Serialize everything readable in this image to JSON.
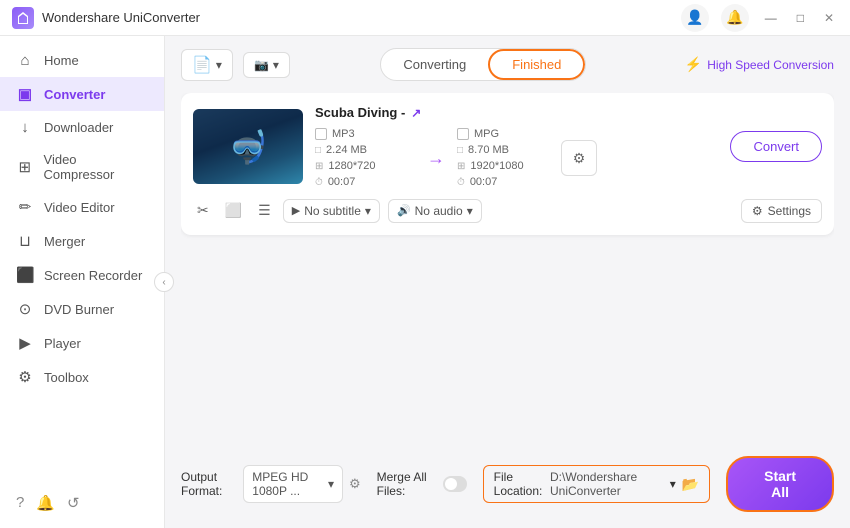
{
  "app": {
    "title": "Wondershare UniConverter"
  },
  "titlebar": {
    "icons": {
      "user": "👤",
      "bell": "🔔",
      "minimize": "—",
      "maximize": "□",
      "close": "✕"
    }
  },
  "sidebar": {
    "items": [
      {
        "id": "home",
        "label": "Home",
        "icon": "⌂"
      },
      {
        "id": "converter",
        "label": "Converter",
        "icon": "▣",
        "active": true
      },
      {
        "id": "downloader",
        "label": "Downloader",
        "icon": "↓"
      },
      {
        "id": "video-compressor",
        "label": "Video Compressor",
        "icon": "⊞"
      },
      {
        "id": "video-editor",
        "label": "Video Editor",
        "icon": "✏"
      },
      {
        "id": "merger",
        "label": "Merger",
        "icon": "⊔"
      },
      {
        "id": "screen-recorder",
        "label": "Screen Recorder",
        "icon": "⬛"
      },
      {
        "id": "dvd-burner",
        "label": "DVD Burner",
        "icon": "⊙"
      },
      {
        "id": "player",
        "label": "Player",
        "icon": "▶"
      },
      {
        "id": "toolbox",
        "label": "Toolbox",
        "icon": "⚙"
      }
    ],
    "bottom_icons": [
      "?",
      "🔔",
      "↺"
    ]
  },
  "topbar": {
    "add_btn": "Add Files",
    "add_icon": "+",
    "snapshot_icon": "📷",
    "tab_converting": "Converting",
    "tab_finished": "Finished",
    "speed_label": "High Speed Conversion",
    "bolt": "⚡"
  },
  "media_card": {
    "title": "Scuba Diving -",
    "ext_icon": "↗",
    "source": {
      "format": "MP3",
      "size": "2.24 MB",
      "resolution": "1280*720",
      "duration": "00:07"
    },
    "target": {
      "format": "MPG",
      "size": "8.70 MB",
      "resolution": "1920*1080",
      "duration": "00:07"
    },
    "subtitle_label": "No subtitle",
    "audio_label": "No audio",
    "settings_label": "Settings",
    "convert_label": "Convert"
  },
  "bottom": {
    "output_format_label": "Output Format:",
    "output_format_value": "MPEG HD 1080P ...",
    "merge_files_label": "Merge All Files:",
    "file_location_label": "File Location:",
    "file_location_path": "D:\\Wondershare UniConverter",
    "start_all_label": "Start All"
  }
}
